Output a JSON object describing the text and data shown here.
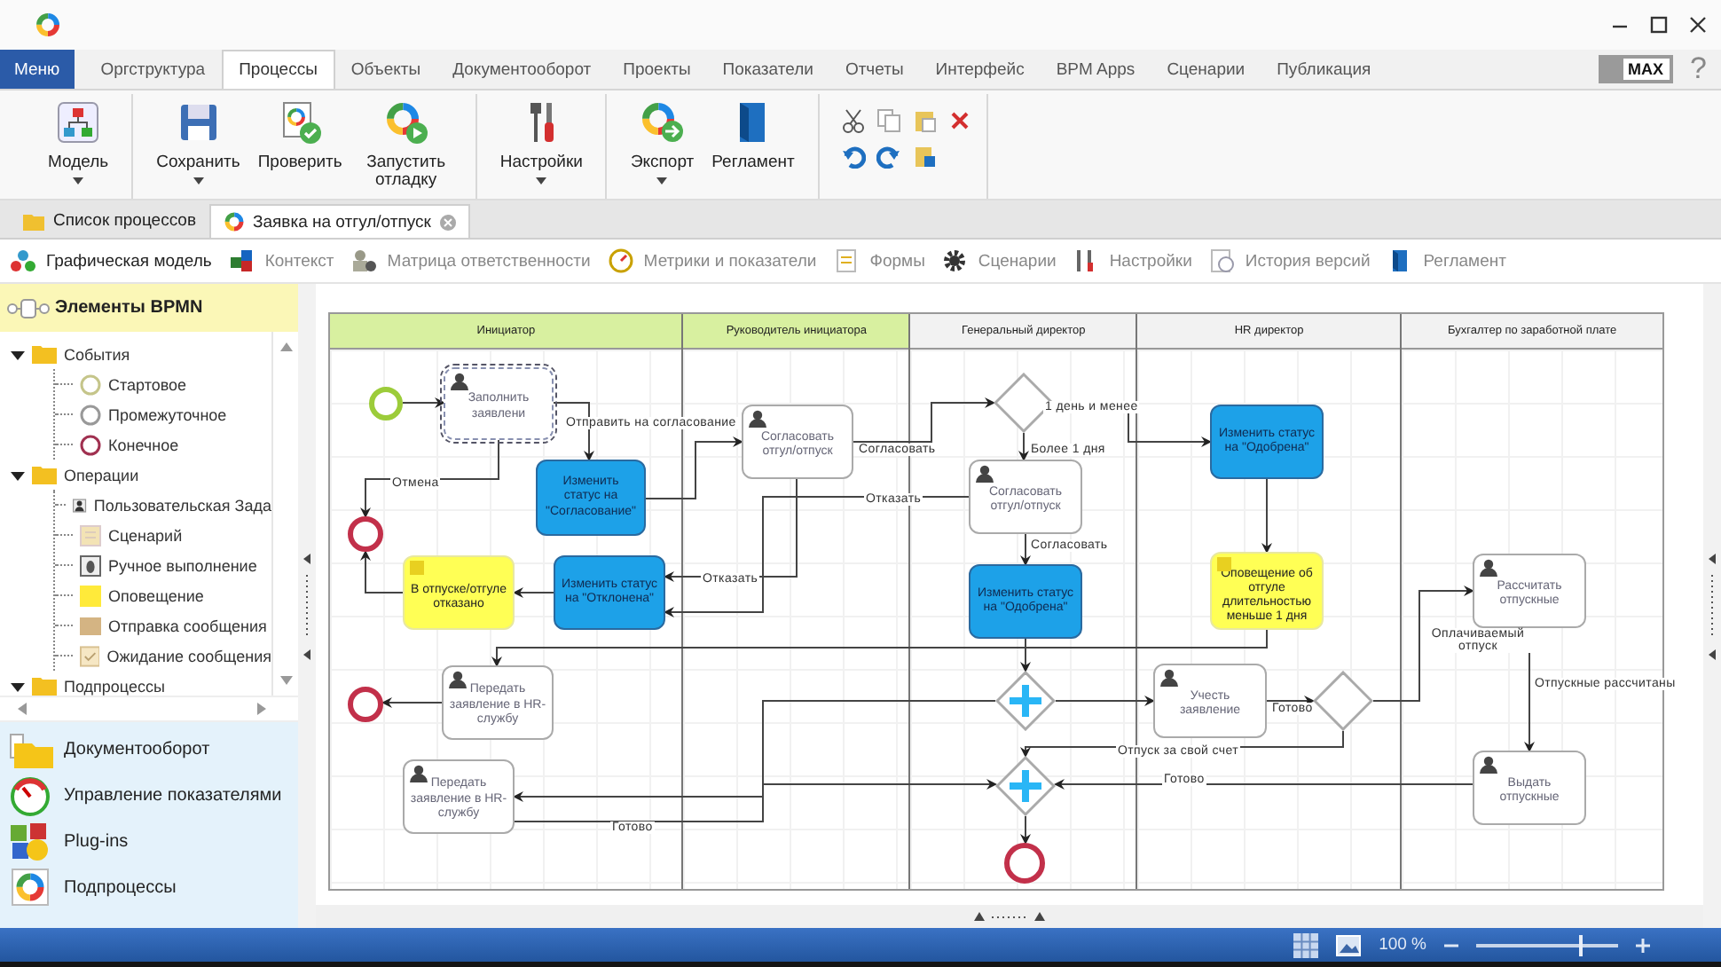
{
  "menu_button": "Меню",
  "ribbon_tabs": [
    {
      "label": "Оргструктура",
      "selected": false
    },
    {
      "label": "Процессы",
      "selected": true
    },
    {
      "label": "Объекты",
      "selected": false
    },
    {
      "label": "Документооборот",
      "selected": false
    },
    {
      "label": "Проекты",
      "selected": false
    },
    {
      "label": "Показатели",
      "selected": false
    },
    {
      "label": "Отчеты",
      "selected": false
    },
    {
      "label": "Интерфейс",
      "selected": false
    },
    {
      "label": "BPM Apps",
      "selected": false
    },
    {
      "label": "Сценарии",
      "selected": false
    },
    {
      "label": "Публикация",
      "selected": false
    }
  ],
  "max_button": "MAX",
  "help_button": "?",
  "ribbon_groups": [
    {
      "buttons": [
        {
          "label": "Модель",
          "dropdown": true
        }
      ]
    },
    {
      "buttons": [
        {
          "label": "Сохранить",
          "dropdown": true
        },
        {
          "label": "Проверить",
          "dropdown": false
        },
        {
          "label": "Запустить отладку",
          "dropdown": false
        }
      ]
    },
    {
      "buttons": [
        {
          "label": "Настройки",
          "dropdown": true
        }
      ]
    },
    {
      "buttons": [
        {
          "label": "Экспорт",
          "dropdown": true
        },
        {
          "label": "Регламент",
          "dropdown": false
        }
      ]
    }
  ],
  "doc_tabs": [
    {
      "label": "Список процессов",
      "selected": false,
      "closable": false
    },
    {
      "label": "Заявка на отгул/отпуск",
      "selected": true,
      "closable": true
    }
  ],
  "view_tabs": [
    {
      "label": "Графическая модель",
      "selected": true
    },
    {
      "label": "Контекст",
      "selected": false
    },
    {
      "label": "Матрица ответственности",
      "selected": false
    },
    {
      "label": "Метрики и показатели",
      "selected": false
    },
    {
      "label": "Формы",
      "selected": false
    },
    {
      "label": "Сценарии",
      "selected": false
    },
    {
      "label": "Настройки",
      "selected": false
    },
    {
      "label": "История версий",
      "selected": false
    },
    {
      "label": "Регламент",
      "selected": false
    }
  ],
  "palette": {
    "title": "Элементы BPMN",
    "tree": [
      {
        "label": "События",
        "expanded": true,
        "children": [
          {
            "label": "Стартовое",
            "kind": "start"
          },
          {
            "label": "Промежуточное",
            "kind": "intermediate"
          },
          {
            "label": "Конечное",
            "kind": "end"
          }
        ]
      },
      {
        "label": "Операции",
        "expanded": true,
        "children": [
          {
            "label": "Пользовательская Зада",
            "kind": "user"
          },
          {
            "label": "Сценарий",
            "kind": "script"
          },
          {
            "label": "Ручное выполнение",
            "kind": "manual"
          },
          {
            "label": "Оповещение",
            "kind": "notify"
          },
          {
            "label": "Отправка сообщения",
            "kind": "send"
          },
          {
            "label": "Ожидание сообщения",
            "kind": "receive"
          }
        ]
      },
      {
        "label": "Подпроцессы",
        "expanded": true
      }
    ]
  },
  "nav": [
    {
      "label": "Документооборот",
      "kind": "documents"
    },
    {
      "label": "Управление показателями",
      "kind": "metrics"
    },
    {
      "label": "Plug-ins",
      "kind": "plugins"
    },
    {
      "label": "Подпроцессы",
      "kind": "subprocess"
    }
  ],
  "lanes": [
    {
      "title": "Инициатор",
      "highlighted": true
    },
    {
      "title": "Руководитель инициатора",
      "highlighted": true
    },
    {
      "title": "Генеральный директор",
      "highlighted": false
    },
    {
      "title": "HR директор",
      "highlighted": false
    },
    {
      "title": "Бухгалтер по заработной плате",
      "highlighted": false
    }
  ],
  "nodes": [
    {
      "kind": "start",
      "selected": false
    },
    {
      "kind": "task",
      "text": "Заполнить заявлени",
      "selected": true
    },
    {
      "kind": "end",
      "selected": false
    },
    {
      "kind": "service",
      "text": "Изменить статус на \"Согласование\"",
      "selected": false
    },
    {
      "kind": "notify",
      "text": "В отпуске/отгуле отказано",
      "selected": false
    },
    {
      "kind": "service",
      "text": "Изменить статус на \"Отклонена\"",
      "selected": false
    },
    {
      "kind": "task",
      "text": "Согласовать отгул/отпуск",
      "selected": false
    },
    {
      "kind": "end",
      "selected": false
    },
    {
      "kind": "task",
      "text": "Передать заявление в HR-службу",
      "selected": false
    },
    {
      "kind": "task",
      "text": "Передать заявление в HR-службу",
      "selected": false
    },
    {
      "kind": "exclusive",
      "selected": false
    },
    {
      "kind": "task",
      "text": "Согласовать отгул/отпуск",
      "selected": false
    },
    {
      "kind": "service",
      "text": "Изменить статус на \"Одобрена\"",
      "selected": false
    },
    {
      "kind": "parallel",
      "selected": false
    },
    {
      "kind": "parallel",
      "selected": false
    },
    {
      "kind": "end",
      "selected": false
    },
    {
      "kind": "service",
      "text": "Изменить статус на \"Одобрена\"",
      "selected": false
    },
    {
      "kind": "notify",
      "text": "Оповещение об отгуле длительностью меньше 1 дня",
      "selected": false
    },
    {
      "kind": "task",
      "text": "Учесть заявление",
      "selected": false
    },
    {
      "kind": "exclusive",
      "selected": false
    },
    {
      "kind": "task",
      "text": "Рассчитать отпускные",
      "selected": false
    },
    {
      "kind": "task",
      "text": "Выдать отпускные",
      "selected": false
    }
  ],
  "edge_labels": [
    "Отправить на согласование",
    "Согласовать",
    "Отмена",
    "Отказать",
    "Отказать",
    "Готово",
    "1 день и менее",
    "Более 1 дня",
    "Согласовать",
    "Оплачиваемый отпуск",
    "Отпускные рассчитаны",
    "Готово",
    "Отпуск за свой счет",
    "Готово"
  ],
  "status_bar": {
    "zoom": "100 %",
    "zoom_slider": {
      "level": 0.72
    }
  }
}
